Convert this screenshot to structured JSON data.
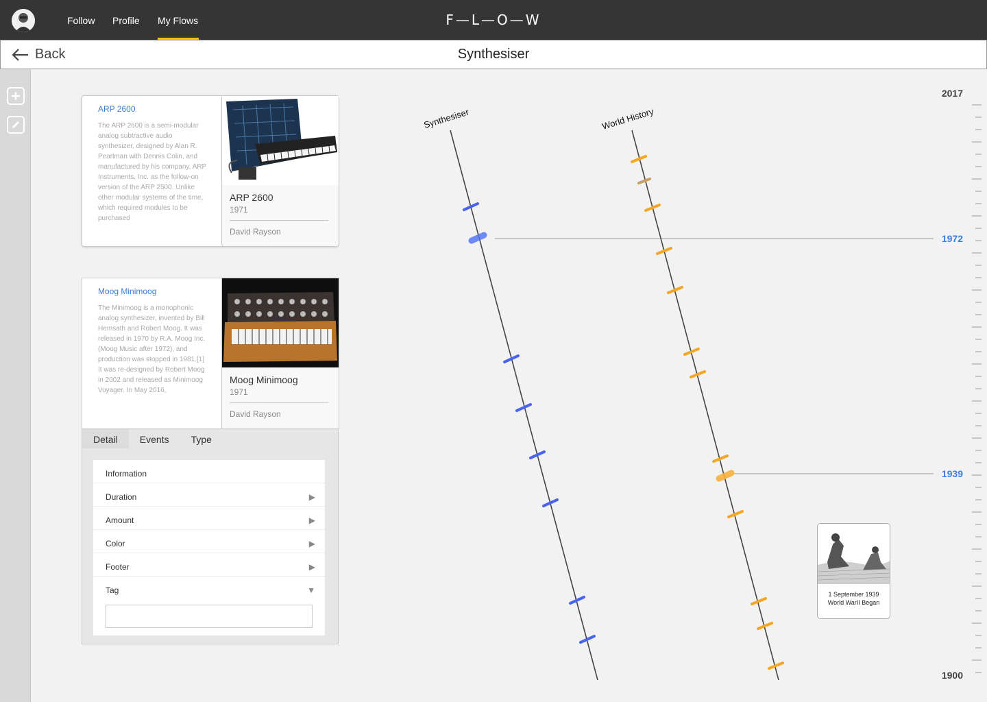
{
  "app": {
    "brand": "F—L—O—W"
  },
  "nav": {
    "items": [
      {
        "label": "Follow"
      },
      {
        "label": "Profile"
      },
      {
        "label": "My Flows",
        "active": true
      }
    ]
  },
  "titlebar": {
    "back_label": "Back",
    "title": "Synthesiser"
  },
  "rail": {
    "buttons": [
      {
        "icon": "plus-icon"
      },
      {
        "icon": "pencil-icon"
      }
    ]
  },
  "cards": [
    {
      "link": "ARP 2600",
      "description": "The ARP 2600 is a semi-modular analog subtractive audio synthesizer, designed by Alan R. Pearlman with Dennis Colin, and manufactured by his company, ARP Instruments, Inc. as the follow-on version of the ARP 2500. Unlike other modular systems of the time, which required modules to be purchased",
      "title": "ARP 2600",
      "year": "1971",
      "author": "David Rayson"
    },
    {
      "link": "Moog Minimoog",
      "description": "The Minimoog is a monophonic analog synthesizer, invented by Bill Hemsath and Robert Moog. It was released in 1970 by R.A. Moog Inc. (Moog Music after 1972), and production was stopped in 1981.[1] It was re-designed by Robert Moog in 2002 and released as Minimoog Voyager. In May 2016,",
      "title": "Moog Minimoog",
      "year": "1971",
      "author": "David Rayson"
    }
  ],
  "detail": {
    "tabs": [
      {
        "label": "Detail",
        "active": true
      },
      {
        "label": "Events"
      },
      {
        "label": "Type"
      }
    ],
    "rows": [
      {
        "label": "Information",
        "arrow": ""
      },
      {
        "label": "Duration",
        "arrow": "▶"
      },
      {
        "label": "Amount",
        "arrow": "▶"
      },
      {
        "label": "Color",
        "arrow": "▶"
      },
      {
        "label": "Footer",
        "arrow": "▶"
      },
      {
        "label": "Tag",
        "arrow": "▼"
      }
    ],
    "tag_value": ""
  },
  "timeline": {
    "start_year": 1900,
    "end_year": 2017,
    "year_labels": [
      "2017",
      "1900"
    ],
    "highlights": [
      {
        "year": "1972",
        "flow": "Synthesiser"
      },
      {
        "year": "1939",
        "flow": "World History"
      }
    ],
    "flows": [
      {
        "name": "Synthesiser",
        "color": "#4a63f0",
        "event_count": 10
      },
      {
        "name": "World History",
        "color": "#f5a623",
        "event_count": 15
      }
    ]
  },
  "event_card": {
    "line1": "1 September 1939",
    "line2": "World WarII Began"
  }
}
